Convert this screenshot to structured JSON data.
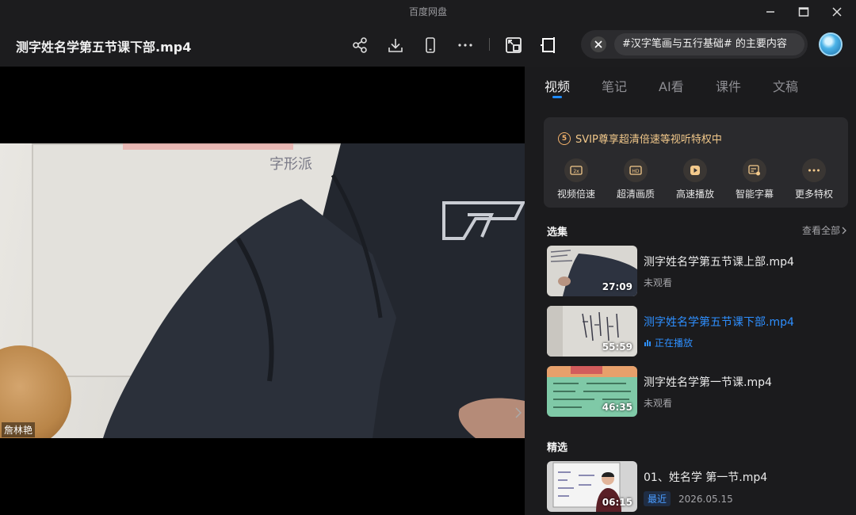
{
  "app": {
    "title": "百度网盘"
  },
  "header": {
    "file_title": "测字姓名学第五节课下部.mp4",
    "search_query": "#汉字笔画与五行基础# 的主要内容"
  },
  "video": {
    "whiteboard_text": "字形派",
    "watermark_name": "詹林艳"
  },
  "panel": {
    "tabs": [
      {
        "label": "视频",
        "active": true
      },
      {
        "label": "笔记"
      },
      {
        "label": "AI看"
      },
      {
        "label": "课件"
      },
      {
        "label": "文稿"
      }
    ],
    "svip": {
      "badge": "5",
      "headline": "SVIP尊享超清倍速等视听特权中",
      "perks": [
        {
          "label": "视频倍速",
          "icon": "speed-icon"
        },
        {
          "label": "超清画质",
          "icon": "hd-icon"
        },
        {
          "label": "高速播放",
          "icon": "fast-play-icon"
        },
        {
          "label": "智能字幕",
          "icon": "subtitle-icon"
        },
        {
          "label": "更多特权",
          "icon": "more-icon"
        }
      ]
    },
    "episodes_title": "选集",
    "view_all": "查看全部",
    "episodes": [
      {
        "title": "测字姓名学第五节课上部.mp4",
        "duration": "27:09",
        "status": "未观看"
      },
      {
        "title": "测字姓名学第五节课下部.mp4",
        "duration": "55:59",
        "status": "正在播放",
        "playing": true
      },
      {
        "title": "测字姓名学第一节课.mp4",
        "duration": "46:35",
        "status": "未观看"
      }
    ],
    "featured_title": "精选",
    "featured": [
      {
        "title": "01、姓名学 第一节.mp4",
        "duration": "06:15",
        "tag": "最近",
        "date": "2026.05.15"
      }
    ]
  },
  "colors": {
    "accent": "#1f8cff",
    "svip_gold": "#f3c98b",
    "panel_bg": "#1b1b1d"
  }
}
